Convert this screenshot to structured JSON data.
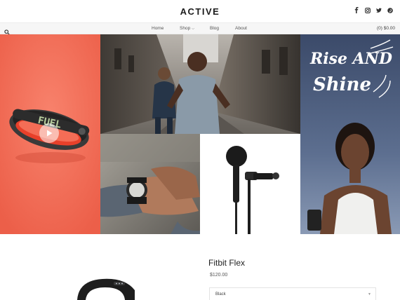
{
  "header": {
    "logo": "ACTIVE",
    "social_icons": [
      "facebook-icon",
      "instagram-icon",
      "twitter-icon",
      "pinterest-icon"
    ]
  },
  "nav": {
    "items": [
      {
        "label": "Home"
      },
      {
        "label": "Shop"
      },
      {
        "label": "Blog"
      },
      {
        "label": "About"
      }
    ],
    "cart": "(0) $0.00"
  },
  "hero": {
    "band_display_text": "FUEL",
    "poster_text_line1": "Rise AND",
    "poster_text_line2": "Shine"
  },
  "product": {
    "title": "Fitbit Flex",
    "price": "$120.00",
    "variant": "Black"
  },
  "colors": {
    "coral": "#f46d56",
    "poster_sky": "#4a5a7a"
  }
}
